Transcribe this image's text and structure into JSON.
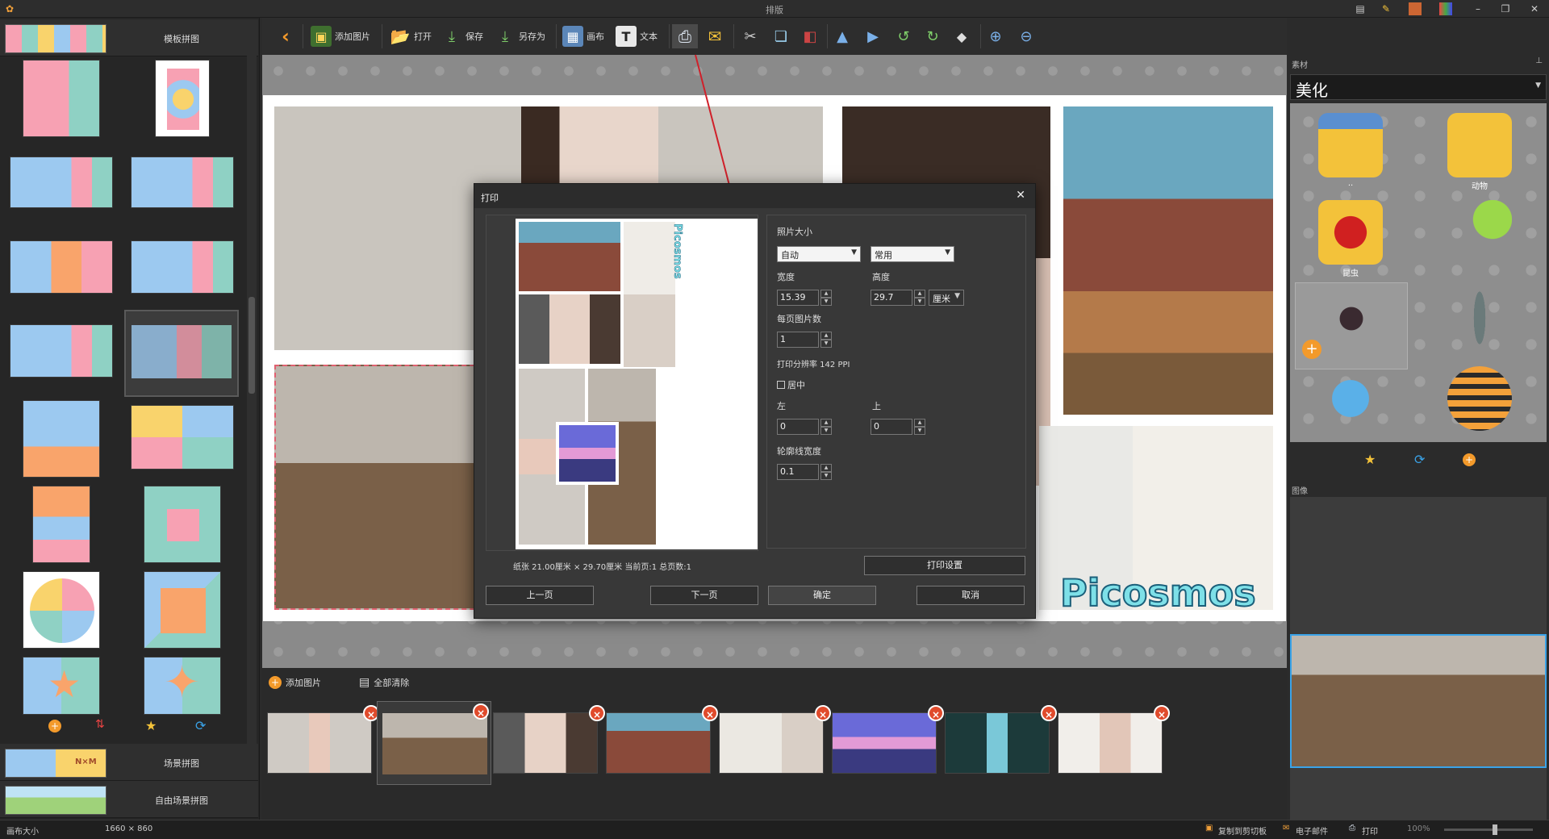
{
  "window": {
    "title": "排版"
  },
  "toolbar": {
    "add_image": "添加图片",
    "open": "打开",
    "save": "保存",
    "save_as": "另存为",
    "canvas": "画布",
    "text": "文本"
  },
  "left_panel": {
    "category_template": "模板拼图",
    "category_scene": "场景拼图",
    "category_free_scene": "自由场景拼图",
    "scene_thumb_text": "N×M"
  },
  "bottom_strip": {
    "add_image": "添加图片",
    "clear_all": "全部清除"
  },
  "right_panel": {
    "materials_title": "素材",
    "beautify": "美化",
    "image_title": "图像",
    "items": [
      {
        "name": "..",
        "icon": "folder-up-icon"
      },
      {
        "name": "动物",
        "icon": "folder-animal-icon"
      },
      {
        "name": "昆虫",
        "icon": "folder-insect-icon"
      },
      {
        "name": "",
        "icon": "caterpillar-icon"
      },
      {
        "name": "",
        "icon": "spider-icon"
      },
      {
        "name": "",
        "icon": "dragonfly-icon"
      },
      {
        "name": "",
        "icon": "butterfly-icon"
      },
      {
        "name": "",
        "icon": "bee-icon"
      }
    ]
  },
  "canvas": {
    "watermark": "Picosmos"
  },
  "status": {
    "canvas_size_label": "画布大小",
    "canvas_size_value": "1660 × 860",
    "copy_clipboard": "复制到剪切板",
    "email": "电子邮件",
    "print": "打印",
    "zoom": "100%"
  },
  "print_dialog": {
    "title": "打印",
    "photo_size_label": "照片大小",
    "size_mode": "自动",
    "size_preset": "常用",
    "width_label": "宽度",
    "height_label": "高度",
    "width_value": "15.39",
    "height_value": "29.7",
    "unit": "厘米",
    "per_page_label": "每页图片数",
    "per_page_value": "1",
    "resolution_text": "打印分辨率 142 PPI",
    "center_label": "居中",
    "left_label": "左",
    "top_label": "上",
    "left_value": "0",
    "top_value": "0",
    "outline_label": "轮廓线宽度",
    "outline_value": "0.1",
    "print_settings": "打印设置",
    "paper_info": "纸张 21.00厘米 × 29.70厘米 当前页:1 总页数:1",
    "prev_page": "上一页",
    "next_page": "下一页",
    "ok": "确定",
    "cancel": "取消",
    "preview_watermark": "Picosmos"
  },
  "colors": {
    "accent_orange": "#f39a2b",
    "delete_red": "#e04b2c",
    "arrow_red": "#d0202a",
    "selection_blue": "#3aa3e8"
  }
}
